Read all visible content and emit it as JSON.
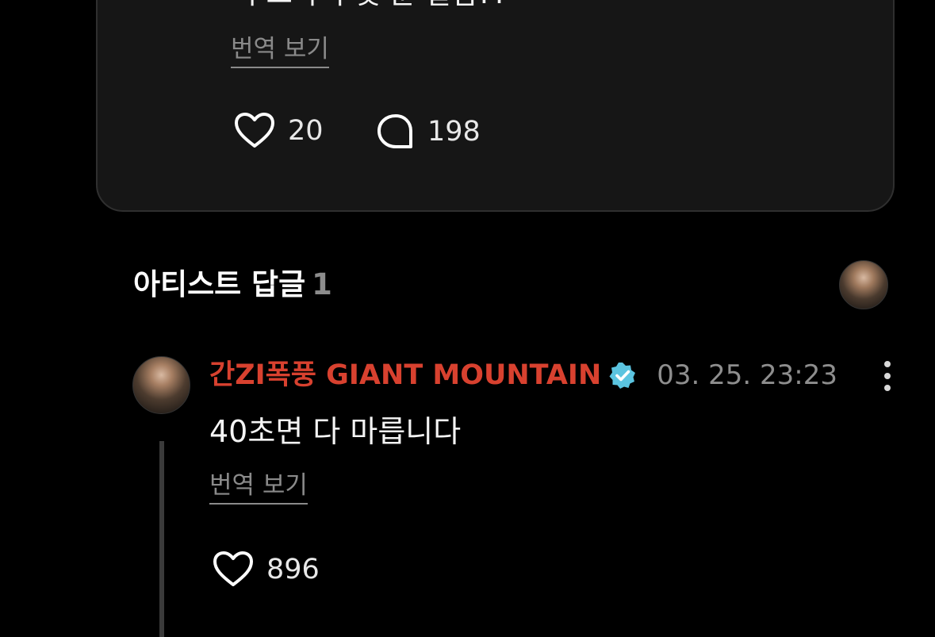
{
  "fan_comment": {
    "text": "너 드라이 몇 분 걸림??",
    "translate_label": "번역 보기",
    "like_count": "20",
    "reply_count": "198",
    "icons": {
      "like": "heart-outline-icon",
      "reply": "speech-bubble-icon"
    }
  },
  "artist_replies": {
    "title": "아티스트 답글",
    "count": "1"
  },
  "artist_reply": {
    "author": "간ZI폭풍 GIANT MOUNTAIN",
    "timestamp": "03. 25. 23:23",
    "text": "40초면 다 마릅니다",
    "translate_label": "번역 보기",
    "like_count": "896",
    "icons": {
      "verified": "verified-badge-icon",
      "more": "more-vertical-icon",
      "like": "heart-outline-icon"
    }
  },
  "colors": {
    "background": "#000000",
    "card": "#161616",
    "artist_name": "#d8412f",
    "verified_badge": "#5bc4e0",
    "muted_text": "#8a8a8a"
  }
}
